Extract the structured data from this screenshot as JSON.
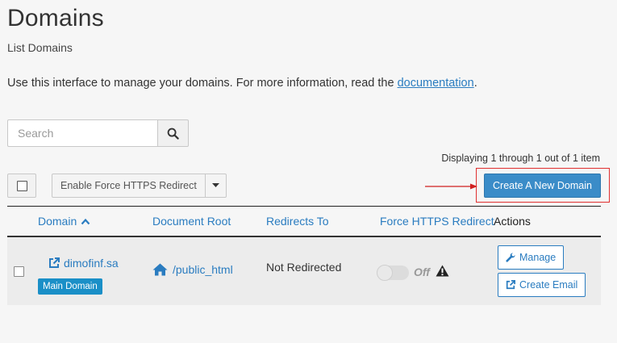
{
  "header": {
    "title": "Domains",
    "subtitle": "List Domains",
    "intro_text": "Use this interface to manage your domains. For more information, read the ",
    "intro_link": "documentation",
    "intro_end": "."
  },
  "search": {
    "placeholder": "Search",
    "value": ""
  },
  "pagination": {
    "displaying": "Displaying 1 through 1 out of 1 item"
  },
  "toolbar": {
    "force_https_label": "Enable Force HTTPS Redirect",
    "create_label": "Create A New Domain"
  },
  "table": {
    "columns": {
      "domain": "Domain",
      "document_root": "Document Root",
      "redirects_to": "Redirects To",
      "force_https": "Force HTTPS Redirect",
      "actions": "Actions"
    },
    "rows": [
      {
        "domain": "dimofinf.sa",
        "badge": "Main Domain",
        "document_root": "/public_html",
        "redirects_to": "Not Redirected",
        "force_https_state": "Off",
        "actions": {
          "manage": "Manage",
          "create_email": "Create Email"
        }
      }
    ]
  },
  "colors": {
    "link": "#2a7cc0",
    "primary_button": "#3b8cc8",
    "badge": "#1a8fc7",
    "highlight": "#e03030"
  },
  "icons": {
    "search": "search-icon",
    "caret": "caret-down-icon",
    "sort": "sort-ascending-icon",
    "external_link": "external-link-icon",
    "home": "home-icon",
    "warning": "warning-icon",
    "wrench": "wrench-icon",
    "create_email": "external-link-icon"
  }
}
